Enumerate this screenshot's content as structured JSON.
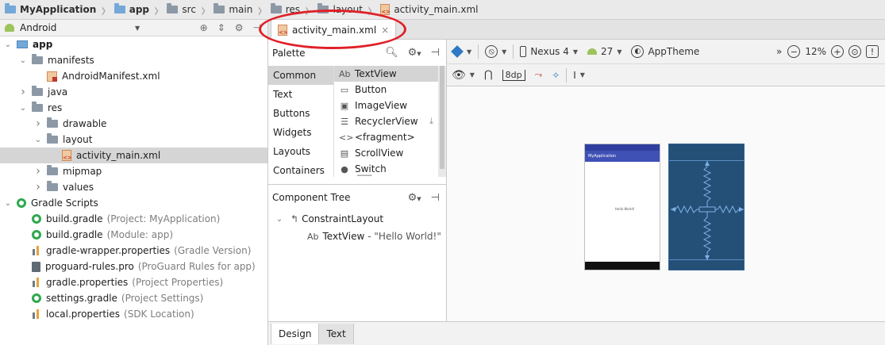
{
  "breadcrumb": [
    {
      "label": "MyApplication",
      "icon": "module-folder-icon",
      "bold": true
    },
    {
      "label": "app",
      "icon": "module-folder-icon",
      "bold": true
    },
    {
      "label": "src",
      "icon": "folder-icon",
      "bold": false
    },
    {
      "label": "main",
      "icon": "folder-icon",
      "bold": false
    },
    {
      "label": "res",
      "icon": "res-folder-icon",
      "bold": false
    },
    {
      "label": "layout",
      "icon": "folder-icon",
      "bold": false
    },
    {
      "label": "activity_main.xml",
      "icon": "xml-file-icon",
      "bold": false
    }
  ],
  "project_view": {
    "selector_label": "Android",
    "tree": [
      {
        "label": "app",
        "hint": "",
        "depth": 0,
        "arrow": "down",
        "icon": "module-icon",
        "bold": true,
        "selected": false
      },
      {
        "label": "manifests",
        "hint": "",
        "depth": 1,
        "arrow": "down",
        "icon": "folder-icon",
        "bold": false,
        "selected": false
      },
      {
        "label": "AndroidManifest.xml",
        "hint": "",
        "depth": 2,
        "arrow": "none",
        "icon": "manifest-icon",
        "bold": false,
        "selected": false
      },
      {
        "label": "java",
        "hint": "",
        "depth": 1,
        "arrow": "right",
        "icon": "folder-icon",
        "bold": false,
        "selected": false
      },
      {
        "label": "res",
        "hint": "",
        "depth": 1,
        "arrow": "down",
        "icon": "res-folder-icon",
        "bold": false,
        "selected": false
      },
      {
        "label": "drawable",
        "hint": "",
        "depth": 2,
        "arrow": "right",
        "icon": "folder-icon",
        "bold": false,
        "selected": false
      },
      {
        "label": "layout",
        "hint": "",
        "depth": 2,
        "arrow": "down",
        "icon": "folder-icon",
        "bold": false,
        "selected": false
      },
      {
        "label": "activity_main.xml",
        "hint": "",
        "depth": 3,
        "arrow": "none",
        "icon": "xml-file-icon",
        "bold": false,
        "selected": true
      },
      {
        "label": "mipmap",
        "hint": "",
        "depth": 2,
        "arrow": "right",
        "icon": "folder-icon",
        "bold": false,
        "selected": false
      },
      {
        "label": "values",
        "hint": "",
        "depth": 2,
        "arrow": "right",
        "icon": "folder-icon",
        "bold": false,
        "selected": false
      },
      {
        "label": "Gradle Scripts",
        "hint": "",
        "depth": 0,
        "arrow": "down",
        "icon": "gradle-icon",
        "bold": false,
        "selected": false
      },
      {
        "label": "build.gradle",
        "hint": "(Project: MyApplication)",
        "depth": 1,
        "arrow": "none",
        "icon": "gradle-icon",
        "bold": false,
        "selected": false
      },
      {
        "label": "build.gradle",
        "hint": "(Module: app)",
        "depth": 1,
        "arrow": "none",
        "icon": "gradle-icon",
        "bold": false,
        "selected": false
      },
      {
        "label": "gradle-wrapper.properties",
        "hint": "(Gradle Version)",
        "depth": 1,
        "arrow": "none",
        "icon": "properties-icon",
        "bold": false,
        "selected": false
      },
      {
        "label": "proguard-rules.pro",
        "hint": "(ProGuard Rules for app)",
        "depth": 1,
        "arrow": "none",
        "icon": "proguard-icon",
        "bold": false,
        "selected": false
      },
      {
        "label": "gradle.properties",
        "hint": "(Project Properties)",
        "depth": 1,
        "arrow": "none",
        "icon": "properties-icon",
        "bold": false,
        "selected": false
      },
      {
        "label": "settings.gradle",
        "hint": "(Project Settings)",
        "depth": 1,
        "arrow": "none",
        "icon": "gradle-icon",
        "bold": false,
        "selected": false
      },
      {
        "label": "local.properties",
        "hint": "(SDK Location)",
        "depth": 1,
        "arrow": "none",
        "icon": "properties-icon",
        "bold": false,
        "selected": false
      }
    ]
  },
  "editor_tab": {
    "label": "activity_main.xml",
    "close_glyph": "×"
  },
  "palette": {
    "title": "Palette",
    "categories": [
      "Common",
      "Text",
      "Buttons",
      "Widgets",
      "Layouts",
      "Containers"
    ],
    "selected_category": "Common",
    "items": [
      {
        "icon_glyph": "Ab",
        "label": "TextView",
        "selected": true,
        "download": false
      },
      {
        "icon_glyph": "▭",
        "label": "Button",
        "selected": false,
        "download": false
      },
      {
        "icon_glyph": "▣",
        "label": "ImageView",
        "selected": false,
        "download": false
      },
      {
        "icon_glyph": "☰",
        "label": "RecyclerView",
        "selected": false,
        "download": true
      },
      {
        "icon_glyph": "<>",
        "label": "<fragment>",
        "selected": false,
        "download": false
      },
      {
        "icon_glyph": "▤",
        "label": "ScrollView",
        "selected": false,
        "download": false
      },
      {
        "icon_glyph": "●",
        "label": "Switch",
        "selected": false,
        "download": false
      }
    ]
  },
  "component_tree": {
    "title": "Component Tree",
    "root": "ConstraintLayout",
    "child_label": "TextView",
    "child_string": "- \"Hello World!\""
  },
  "design_toolbar": {
    "device": "Nexus 4",
    "api": "27",
    "theme": "AppTheme",
    "zoom": "12%",
    "margin": "8dp",
    "more_glyph": "»"
  },
  "preview": {
    "app_title": "MyApplication",
    "hello": "Hello World!"
  },
  "bottom_tabs": [
    "Design",
    "Text"
  ],
  "colors": {
    "annotation_red": "#e02028",
    "blueprint_bg": "#244f77",
    "app_primary": "#3f51b5",
    "status_bar": "#303f9f"
  }
}
